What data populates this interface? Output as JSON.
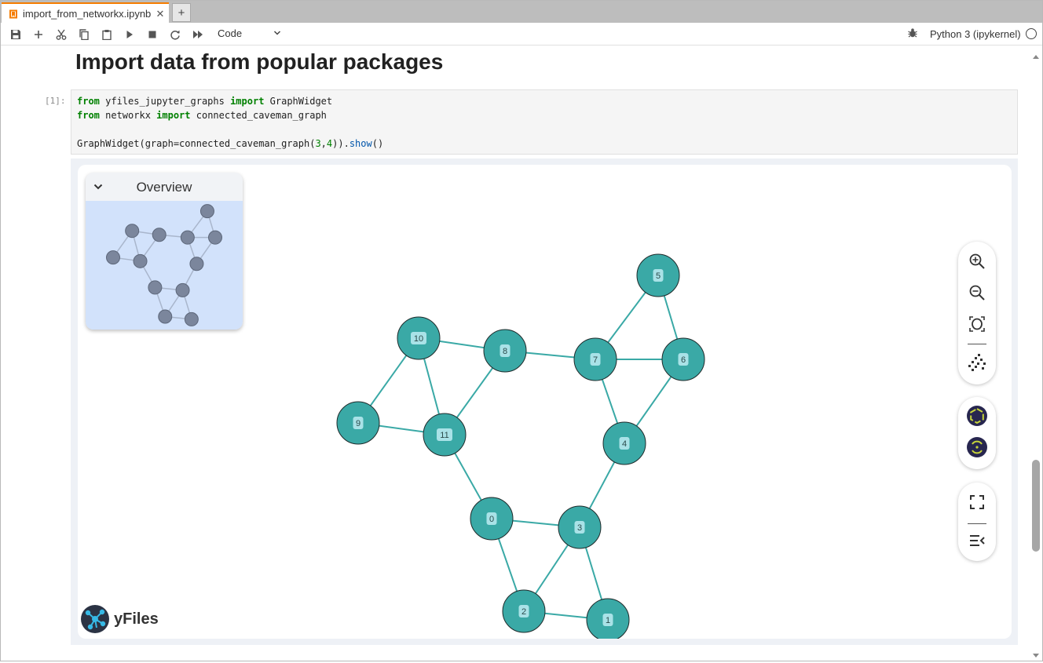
{
  "tab": {
    "filename": "import_from_networkx.ipynb",
    "close_symbol": "✕",
    "add_symbol": "+"
  },
  "toolbar": {
    "buttons": [
      "save-icon",
      "add-cell-icon",
      "cut-icon",
      "copy-icon",
      "paste-icon",
      "run-icon",
      "stop-icon",
      "restart-icon",
      "run-all-icon"
    ],
    "cell_type": "Code",
    "kernel_name": "Python 3 (ipykernel)"
  },
  "notebook": {
    "heading": "Import data from popular packages",
    "cell_prompt": "[1]:",
    "code": {
      "line1": {
        "kw1": "from",
        "mod": " yfiles_jupyter_graphs ",
        "kw2": "import",
        "name": " GraphWidget"
      },
      "line2": {
        "kw1": "from",
        "mod": " networkx ",
        "kw2": "import",
        "name": " connected_caveman_graph"
      },
      "line4": {
        "prefix": "GraphWidget(graph=connected_caveman_graph(",
        "a": "3",
        "comma": ",",
        "b": "4",
        "mid": ")).",
        "call": "show",
        "suffix": "()"
      }
    }
  },
  "widget": {
    "overview_title": "Overview",
    "logo_text": "yFiles",
    "colors": {
      "node": "#3aa9a6",
      "edge": "#3aa9a6",
      "node_label_bg": "#a9e2e7",
      "overview_bg": "#d2e2fb",
      "overview_node": "#7b869c"
    },
    "controls": [
      "zoom-in-icon",
      "zoom-out-icon",
      "fit-content-icon",
      "layout-icon",
      "neighborhood-icon",
      "data-explorer-icon",
      "fullscreen-icon",
      "sidebar-icon"
    ],
    "graph": {
      "nodes": [
        "0",
        "1",
        "2",
        "3",
        "4",
        "5",
        "6",
        "7",
        "8",
        "9",
        "10",
        "11"
      ],
      "edges": [
        [
          "0",
          "2"
        ],
        [
          "0",
          "3"
        ],
        [
          "0",
          "11"
        ],
        [
          "1",
          "2"
        ],
        [
          "1",
          "3"
        ],
        [
          "2",
          "3"
        ],
        [
          "3",
          "4"
        ],
        [
          "4",
          "6"
        ],
        [
          "4",
          "7"
        ],
        [
          "5",
          "6"
        ],
        [
          "5",
          "7"
        ],
        [
          "6",
          "7"
        ],
        [
          "7",
          "8"
        ],
        [
          "8",
          "10"
        ],
        [
          "8",
          "11"
        ],
        [
          "9",
          "10"
        ],
        [
          "9",
          "11"
        ],
        [
          "10",
          "11"
        ]
      ]
    }
  }
}
